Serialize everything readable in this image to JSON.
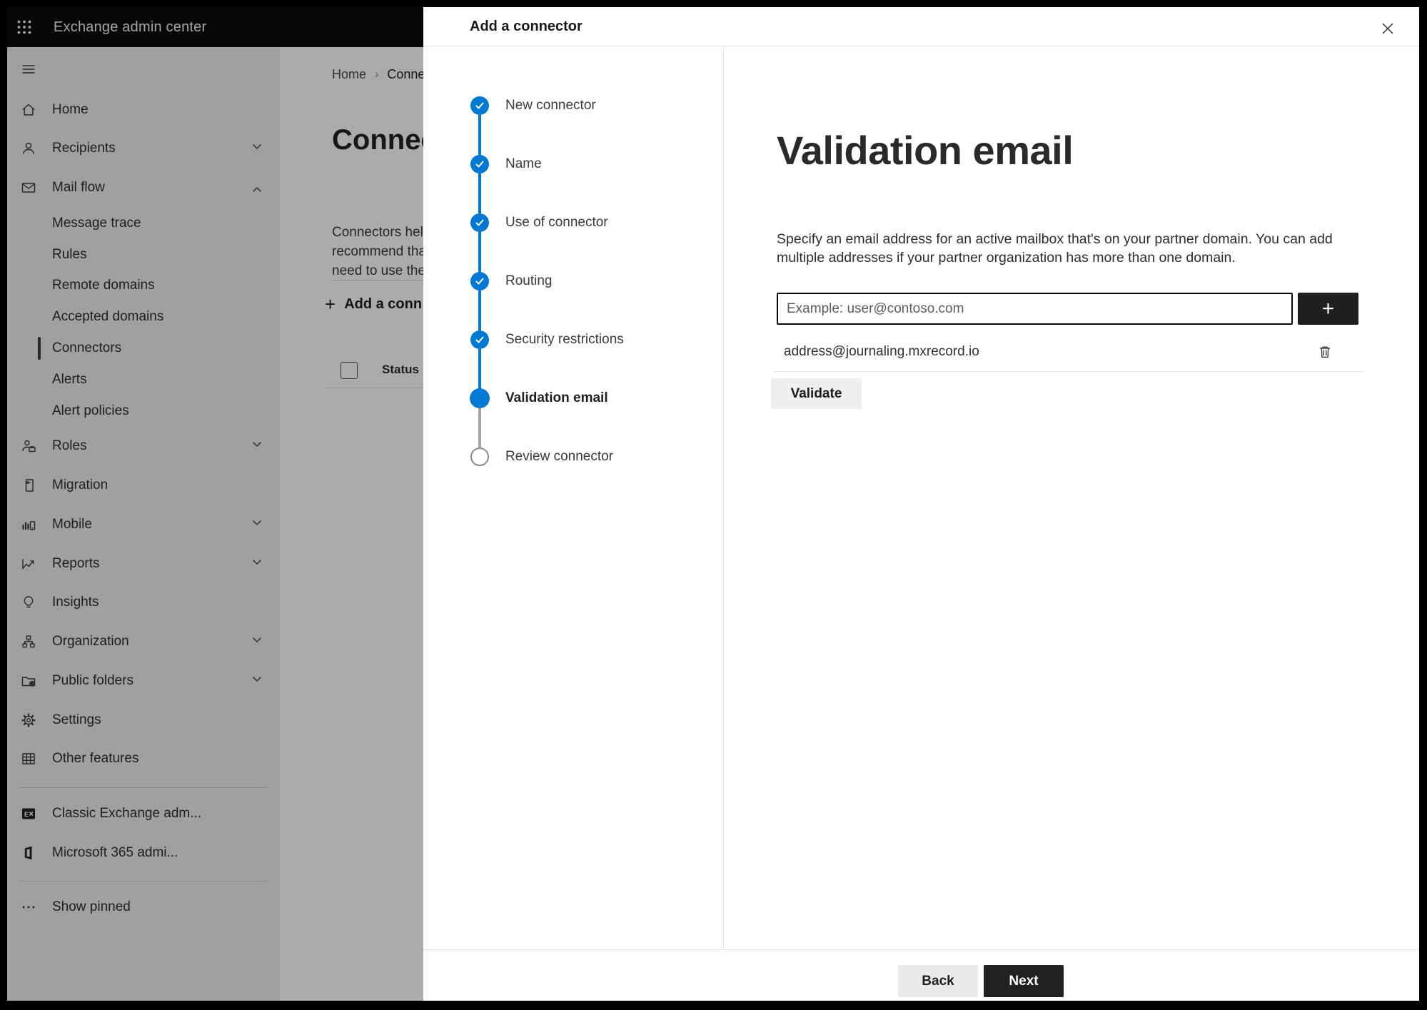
{
  "app_bar": {
    "title": "Exchange admin center"
  },
  "sidebar": {
    "items": [
      {
        "label": "Home",
        "icon": "home-icon"
      },
      {
        "label": "Recipients",
        "icon": "person-icon",
        "chevron": "down"
      },
      {
        "label": "Mail flow",
        "icon": "mail-icon",
        "chevron": "up",
        "expanded": true
      },
      {
        "label": "Message trace",
        "sub": true
      },
      {
        "label": "Rules",
        "sub": true
      },
      {
        "label": "Remote domains",
        "sub": true
      },
      {
        "label": "Accepted domains",
        "sub": true
      },
      {
        "label": "Connectors",
        "sub": true,
        "selected": true
      },
      {
        "label": "Alerts",
        "sub": true
      },
      {
        "label": "Alert policies",
        "sub": true
      },
      {
        "label": "Roles",
        "icon": "roles-icon",
        "chevron": "down"
      },
      {
        "label": "Migration",
        "icon": "migration-icon"
      },
      {
        "label": "Mobile",
        "icon": "mobile-icon",
        "chevron": "down"
      },
      {
        "label": "Reports",
        "icon": "reports-icon",
        "chevron": "down"
      },
      {
        "label": "Insights",
        "icon": "lightbulb-icon"
      },
      {
        "label": "Organization",
        "icon": "org-chart-icon",
        "chevron": "down"
      },
      {
        "label": "Public folders",
        "icon": "folder-globe-icon",
        "chevron": "down"
      },
      {
        "label": "Settings",
        "icon": "gear-icon"
      },
      {
        "label": "Other features",
        "icon": "table-grid-icon"
      }
    ],
    "footer_items": [
      {
        "label": "Classic Exchange adm...",
        "icon": "exchange-logo-icon"
      },
      {
        "label": "Microsoft 365 admi...",
        "icon": "office-logo-icon"
      }
    ],
    "show_pinned": "Show pinned"
  },
  "page": {
    "breadcrumb": {
      "home": "Home",
      "current": "Conne"
    },
    "title": "Connec",
    "intro_lines": [
      "Connectors help",
      "recommend tha",
      "need to use ther"
    ],
    "add_connector_button": "Add a conn",
    "table": {
      "status_column": "Status"
    }
  },
  "wizard": {
    "title": "Add a connector",
    "steps": [
      {
        "label": "New connector",
        "state": "complete"
      },
      {
        "label": "Name",
        "state": "complete"
      },
      {
        "label": "Use of connector",
        "state": "complete"
      },
      {
        "label": "Routing",
        "state": "complete"
      },
      {
        "label": "Security restrictions",
        "state": "complete"
      },
      {
        "label": "Validation email",
        "state": "current"
      },
      {
        "label": "Review connector",
        "state": "upcoming"
      }
    ]
  },
  "panel": {
    "heading": "Validation email",
    "description": "Specify an email address for an active mailbox that's on your partner domain. You can add multiple addresses if your partner organization has more than one domain.",
    "email_input": {
      "value": "",
      "placeholder": "Example: user@contoso.com"
    },
    "add_address_button": "+",
    "addresses": [
      "address@journaling.mxrecord.io"
    ],
    "validate_button": "Validate",
    "back_button": "Back",
    "next_button": "Next"
  },
  "colors": {
    "accent": "#0078d4",
    "app_bar": "#0c0c0c",
    "primary_button": "#212121",
    "input_border": "#0b0b0b"
  }
}
